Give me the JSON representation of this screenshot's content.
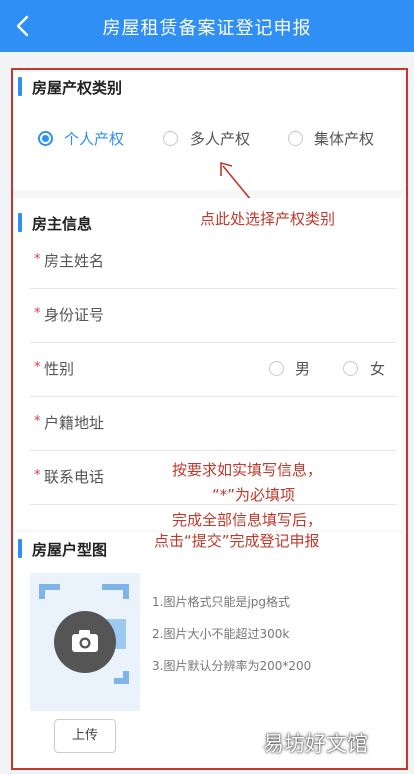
{
  "header": {
    "title": "房屋租赁备案证登记申报",
    "back_icon": "chevron-left-icon"
  },
  "colors": {
    "header_bg": "#2f8ff5",
    "accent": "#2f8ff5",
    "required": "#e4393c",
    "annotation": "#c0392b"
  },
  "property_type": {
    "title": "房屋产权类别",
    "options": [
      {
        "label": "个人产权",
        "selected": true
      },
      {
        "label": "多人产权",
        "selected": false
      },
      {
        "label": "集体产权",
        "selected": false
      }
    ]
  },
  "owner_info": {
    "title": "房主信息",
    "required_mark": "*",
    "fields": [
      {
        "label": "房主姓名"
      },
      {
        "label": "身份证号"
      },
      {
        "label": "性别"
      },
      {
        "label": "户籍地址"
      },
      {
        "label": "联系电话"
      }
    ],
    "gender_options": [
      {
        "label": "男",
        "selected": false
      },
      {
        "label": "女",
        "selected": false
      }
    ]
  },
  "floor_plan": {
    "title": "房屋户型图",
    "tips": [
      "1.图片格式只能是jpg格式",
      "2.图片大小不能超过300k",
      "3.图片默认分辨率为200*200"
    ],
    "upload_label": "上传",
    "camera_icon": "camera-icon"
  },
  "annotations": {
    "select_type": "点此处选择产权类别",
    "fill_lines": [
      "按要求如实填写信息，",
      "“*”为必填项",
      "完成全部信息填写后，",
      "点击“提交”完成登记申报"
    ]
  },
  "watermark": "易坊好文馆"
}
